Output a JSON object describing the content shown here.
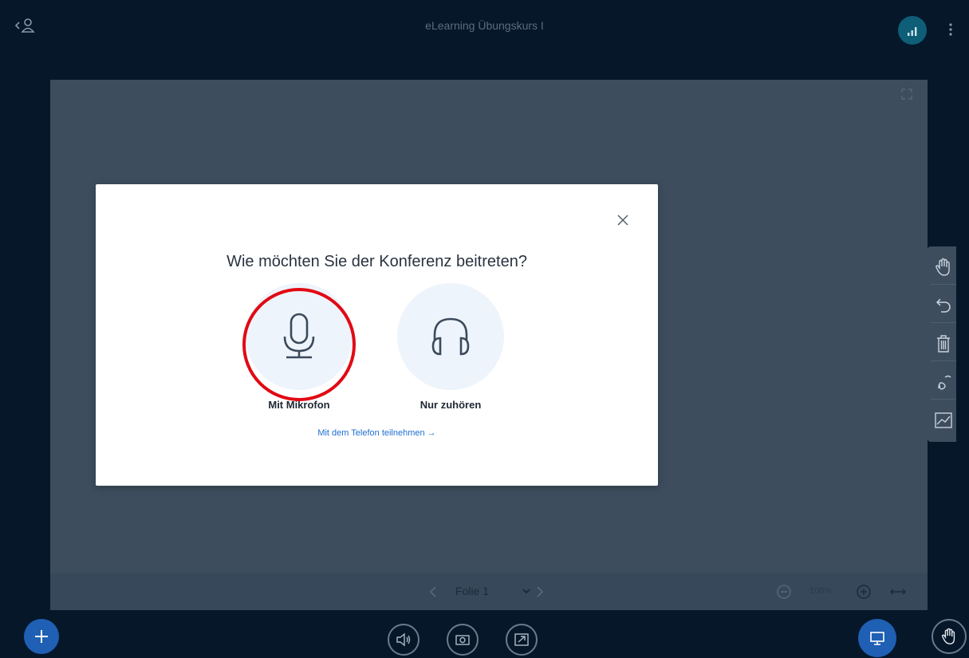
{
  "header": {
    "title": "eLearning Übungskurs I"
  },
  "modal": {
    "title": "Wie möchten Sie der Konferenz beitreten?",
    "options": [
      {
        "label": "Mit Mikrofon",
        "icon": "microphone-icon"
      },
      {
        "label": "Nur zuhören",
        "icon": "headphones-icon"
      }
    ],
    "phone_link": "Mit dem Telefon teilnehmen →"
  },
  "slide_bar": {
    "slide_label": "Folie 1",
    "zoom": "100%"
  },
  "whiteboard_tools": [
    "hand-icon",
    "undo-icon",
    "trash-icon",
    "multi-user-icon",
    "chart-icon"
  ],
  "colors": {
    "background": "#06172a",
    "presentation": "#3d4d5e",
    "primary": "#1f5fb4",
    "link": "#1f6fd1",
    "highlight": "#e10a14"
  }
}
